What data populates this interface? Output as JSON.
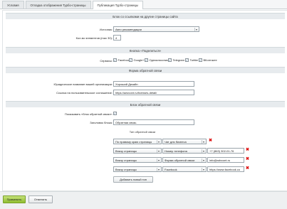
{
  "tabs": [
    "Условия",
    "Отладка отображения Турбо-страницы",
    "Публикация Турбо-страницы"
  ],
  "section_links": {
    "title": "Блок со ссылками на другие страницы сайта",
    "source_label": "Источник:",
    "source_value": "Авто рекомендации",
    "count_label": "Кол-во элементов (max 30):",
    "count_value": "4"
  },
  "section_share": {
    "title": "Кнопка «Поделиться»",
    "label": "Сервисы:",
    "items": [
      "Facebook",
      "Google+",
      "Одноклассники",
      "Telegram",
      "Twitter",
      "ВКонтакте"
    ]
  },
  "section_feedback_form": {
    "title": "Форма обратной связи",
    "org_label": "Юридическое название вашей организации:",
    "org_value": "Хороший Дизайн",
    "agreement_label": "Ссылка на пользовательское соглашение:",
    "agreement_value": "https://advcont.ru/licenses-detail/"
  },
  "section_feedback_block": {
    "title": "Блок обратной связи",
    "show_label": "Показывать «блок обратной связи»:",
    "header_label": "Заголовок блока:",
    "header_value": "Обратная связь",
    "types_label": "Тип обратной связи",
    "rows": [
      {
        "position": "По правому краю страницы",
        "type": "Чат для бизнеса",
        "value": ""
      },
      {
        "position": "Внизу страницы",
        "type": "Номер телефона",
        "value": "+7 (863) 302-01-76"
      },
      {
        "position": "Внизу страницы",
        "type": "Форма обратной связи",
        "value": "info@advcont.ru"
      },
      {
        "position": "Внизу страницы",
        "type": "Facebook",
        "value": "https://www.facebook.co"
      }
    ],
    "add_button": "Добавить новый тип"
  },
  "footer": {
    "apply": "Применить",
    "cancel": "Отменить"
  },
  "colors": {
    "delete": "#dd1111",
    "apply_button": "#9cc63a"
  }
}
